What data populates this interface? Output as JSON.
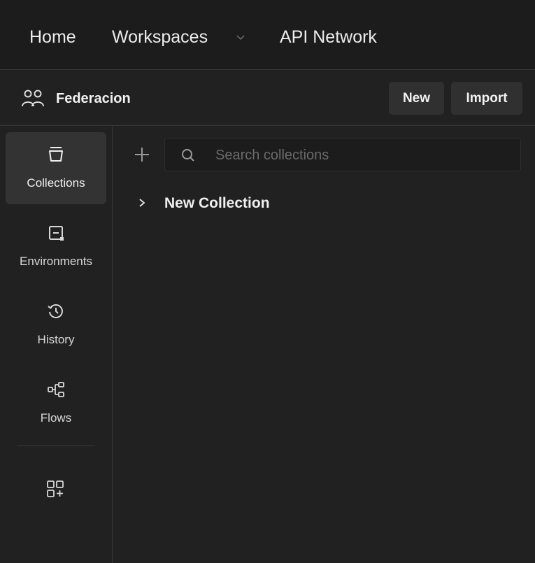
{
  "topnav": {
    "home": "Home",
    "workspaces": "Workspaces",
    "api_network": "API Network"
  },
  "workspace": {
    "name": "Federacion",
    "new_label": "New",
    "import_label": "Import"
  },
  "sidebar": {
    "items": [
      {
        "label": "Collections",
        "icon": "collections-icon",
        "active": true
      },
      {
        "label": "Environments",
        "icon": "environments-icon",
        "active": false
      },
      {
        "label": "History",
        "icon": "history-icon",
        "active": false
      },
      {
        "label": "Flows",
        "icon": "flows-icon",
        "active": false
      }
    ],
    "add_icon": "add-widget-icon"
  },
  "search": {
    "placeholder": "Search collections",
    "value": ""
  },
  "collections": [
    {
      "name": "New Collection",
      "expanded": false
    }
  ],
  "colors": {
    "background": "#212121",
    "topbar": "#1c1c1c",
    "active_item": "#333333",
    "button": "#303030",
    "text": "#e6e6e6"
  }
}
